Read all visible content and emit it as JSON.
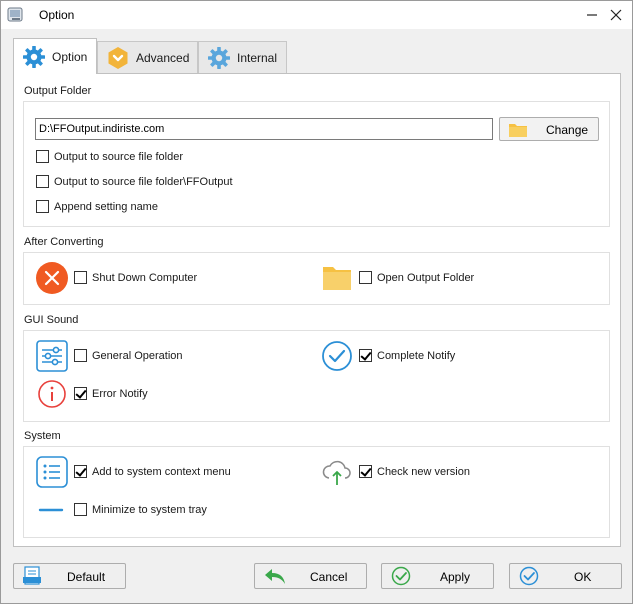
{
  "window": {
    "title": "Option"
  },
  "tabs": [
    {
      "label": "Option",
      "icon": "gear-icon"
    },
    {
      "label": "Advanced",
      "icon": "advanced-badge-icon"
    },
    {
      "label": "Internal",
      "icon": "gear-icon"
    }
  ],
  "output_folder": {
    "title": "Output Folder",
    "path_value": "D:\\FFOutput.indiriste.com",
    "change_label": "Change",
    "options": [
      {
        "label": "Output to source file folder",
        "checked": false
      },
      {
        "label": "Output to source file folder\\FFOutput",
        "checked": false
      },
      {
        "label": "Append setting name",
        "checked": false
      }
    ]
  },
  "after_converting": {
    "title": "After Converting",
    "shut_down_label": "Shut Down Computer",
    "shut_down_checked": false,
    "open_output_label": "Open Output Folder",
    "open_output_checked": false
  },
  "gui_sound": {
    "title": "GUI Sound",
    "general_label": "General Operation",
    "general_checked": false,
    "complete_label": "Complete Notify",
    "complete_checked": true,
    "error_label": "Error Notify",
    "error_checked": true
  },
  "system": {
    "title": "System",
    "context_menu_label": "Add to system context menu",
    "context_menu_checked": true,
    "check_version_label": "Check new version",
    "check_version_checked": true,
    "minimize_tray_label": "Minimize to system tray",
    "minimize_tray_checked": false
  },
  "footer": {
    "default_label": "Default",
    "cancel_label": "Cancel",
    "apply_label": "Apply",
    "ok_label": "OK"
  },
  "colors": {
    "accent_blue": "#2b8fd6",
    "folder_yellow": "#f6c143",
    "shutdown_orange": "#f05a22",
    "error_red": "#e8413c",
    "ok_green": "#3aa84a"
  }
}
